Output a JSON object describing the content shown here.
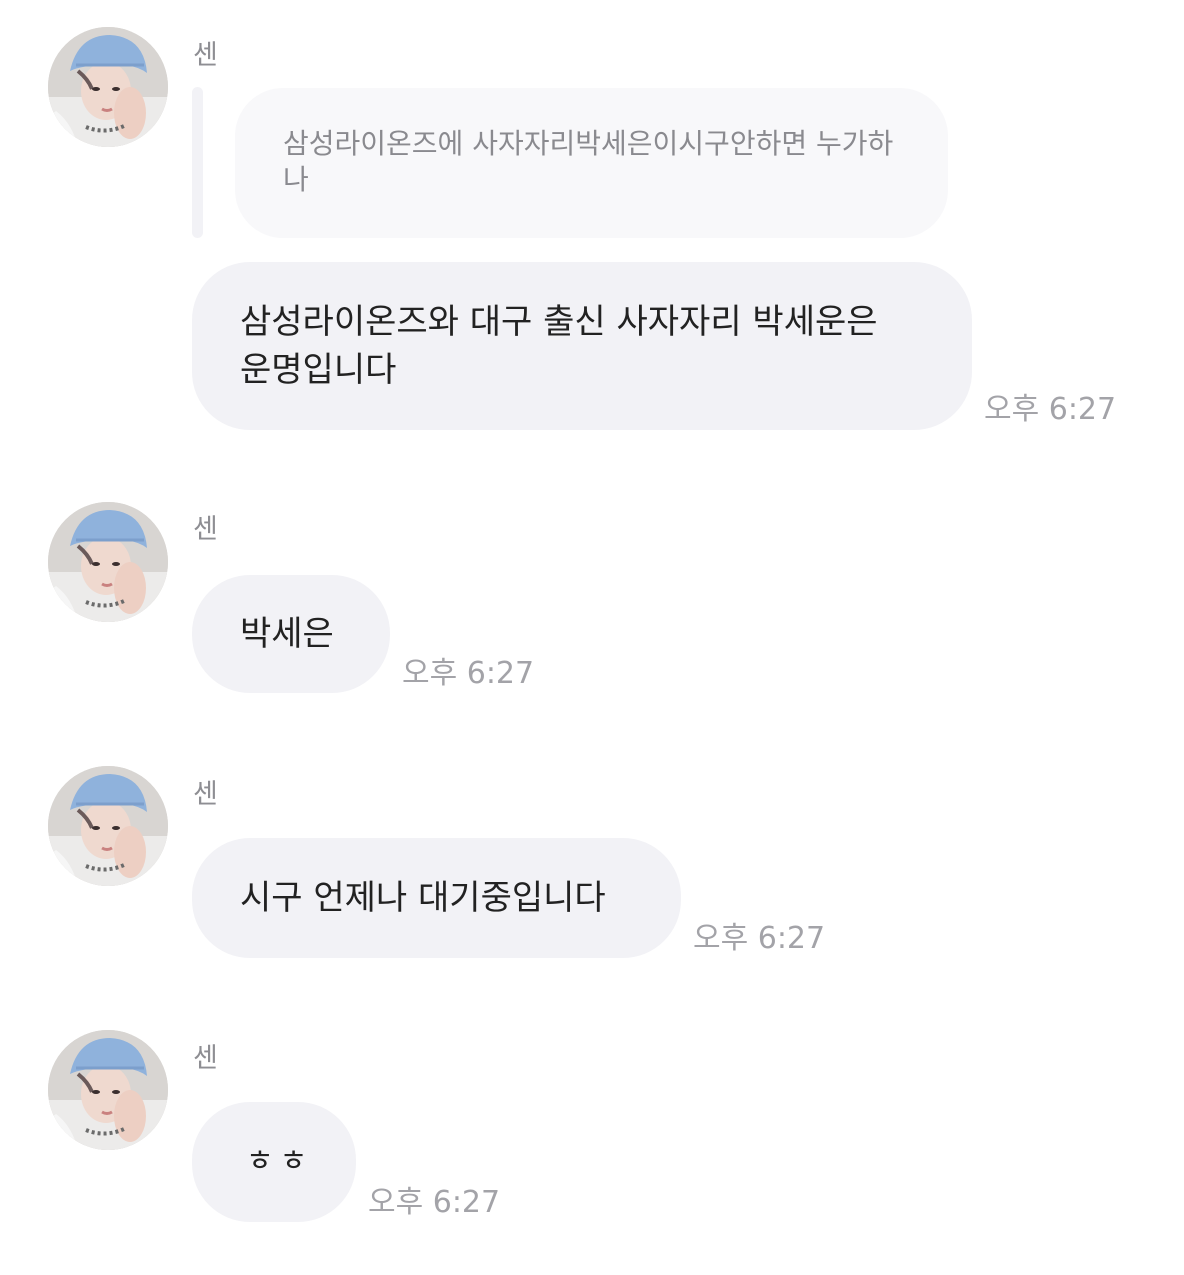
{
  "chat": {
    "messages": [
      {
        "sender": "센",
        "avatar_icon": "profile-photo-avatar",
        "reply_quote": "삼성라이온즈에 사자자리박세은이시구안하면 누가하나",
        "text_line1": "삼성라이온즈와 대구 출신 사자자리 박세운은",
        "text_line2": "운명입니다",
        "time": "오후 6:27"
      },
      {
        "sender": "센",
        "avatar_icon": "profile-photo-avatar",
        "text": "박세은",
        "time": "오후 6:27"
      },
      {
        "sender": "센",
        "avatar_icon": "profile-photo-avatar",
        "text": "시구 언제나 대기중입니다",
        "time": "오후 6:27"
      },
      {
        "sender": "센",
        "avatar_icon": "profile-photo-avatar",
        "text": "ㅎㅎ",
        "time": "오후 6:27"
      }
    ]
  },
  "colors": {
    "bubble_bg": "#f2f2f6",
    "quote_bg": "#f8f8fa",
    "timestamp": "#a3a3a8",
    "sender_name": "#8e8e93"
  }
}
